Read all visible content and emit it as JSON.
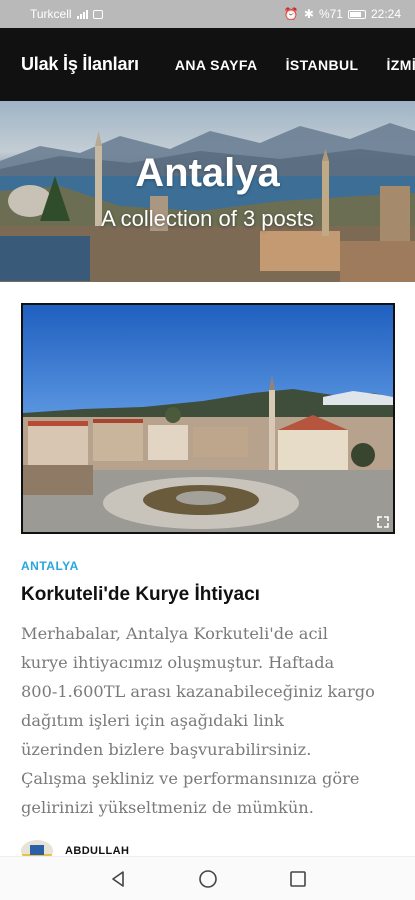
{
  "status_bar": {
    "carrier": "Turkcell",
    "battery": "%71",
    "time": "22:24",
    "icons": [
      "signal-icon",
      "sim-icon",
      "alarm-icon",
      "bluetooth-icon",
      "battery-icon"
    ]
  },
  "navbar": {
    "brand": "Ulak İş İlanları",
    "links": [
      "ANA SAYFA",
      "İSTANBUL",
      "İZMİR"
    ]
  },
  "hero": {
    "title": "Antalya",
    "subtitle": "A collection of 3 posts"
  },
  "post": {
    "category": "ANTALYA",
    "title": "Korkuteli'de Kurye İhtiyacı",
    "excerpt_lines": [
      "Merhabalar, Antalya Korkuteli'de acil",
      "kurye ihtiyacımız oluşmuştur. Haftada",
      "800-1.600TL arası kazanabileceğiniz kargo",
      "dağıtım işleri için aşağıdaki link",
      "üzerinden bizlere başvurabilirsiniz.",
      "Çalışma şekliniz ve performansınıza göre",
      "gelirinizi yükseltmeniz de mümkün."
    ],
    "author": "ABDULLAH"
  },
  "colors": {
    "navbar_bg": "#111111",
    "category_accent": "#27a6e0",
    "excerpt_text": "#7a7a7a",
    "status_bar_bg": "#b9b9b9"
  },
  "system_nav": [
    "back-icon",
    "home-icon",
    "recents-icon"
  ]
}
